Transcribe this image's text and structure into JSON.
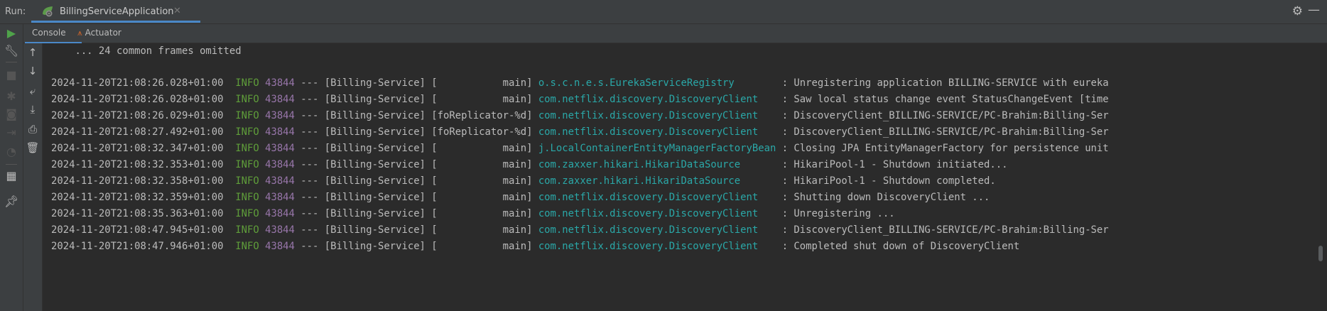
{
  "run": {
    "label": "Run:",
    "config": "BillingServiceApplication"
  },
  "tabs": [
    {
      "label": "Console"
    },
    {
      "label": "Actuator"
    }
  ],
  "console": {
    "omitted": "    ... 24 common frames omitted",
    "logs": [
      {
        "ts": "2024-11-20T21:08:26.028+01:00",
        "level": "INFO",
        "pid": "43844",
        "app": "--- [Billing-Service] [           main] ",
        "logger": "o.s.c.n.e.s.EurekaServiceRegistry       ",
        "msg": " : Unregistering application BILLING-SERVICE with eureka"
      },
      {
        "ts": "2024-11-20T21:08:26.028+01:00",
        "level": "INFO",
        "pid": "43844",
        "app": "--- [Billing-Service] [           main] ",
        "logger": "com.netflix.discovery.DiscoveryClient   ",
        "msg": " : Saw local status change event StatusChangeEvent [time"
      },
      {
        "ts": "2024-11-20T21:08:26.029+01:00",
        "level": "INFO",
        "pid": "43844",
        "app": "--- [Billing-Service] [foReplicator-%d] ",
        "logger": "com.netflix.discovery.DiscoveryClient   ",
        "msg": " : DiscoveryClient_BILLING-SERVICE/PC-Brahim:Billing-Ser"
      },
      {
        "ts": "2024-11-20T21:08:27.492+01:00",
        "level": "INFO",
        "pid": "43844",
        "app": "--- [Billing-Service] [foReplicator-%d] ",
        "logger": "com.netflix.discovery.DiscoveryClient   ",
        "msg": " : DiscoveryClient_BILLING-SERVICE/PC-Brahim:Billing-Ser"
      },
      {
        "ts": "2024-11-20T21:08:32.347+01:00",
        "level": "INFO",
        "pid": "43844",
        "app": "--- [Billing-Service] [           main] ",
        "logger": "j.LocalContainerEntityManagerFactoryBean",
        "msg": " : Closing JPA EntityManagerFactory for persistence unit"
      },
      {
        "ts": "2024-11-20T21:08:32.353+01:00",
        "level": "INFO",
        "pid": "43844",
        "app": "--- [Billing-Service] [           main] ",
        "logger": "com.zaxxer.hikari.HikariDataSource      ",
        "msg": " : HikariPool-1 - Shutdown initiated..."
      },
      {
        "ts": "2024-11-20T21:08:32.358+01:00",
        "level": "INFO",
        "pid": "43844",
        "app": "--- [Billing-Service] [           main] ",
        "logger": "com.zaxxer.hikari.HikariDataSource      ",
        "msg": " : HikariPool-1 - Shutdown completed."
      },
      {
        "ts": "2024-11-20T21:08:32.359+01:00",
        "level": "INFO",
        "pid": "43844",
        "app": "--- [Billing-Service] [           main] ",
        "logger": "com.netflix.discovery.DiscoveryClient   ",
        "msg": " : Shutting down DiscoveryClient ..."
      },
      {
        "ts": "2024-11-20T21:08:35.363+01:00",
        "level": "INFO",
        "pid": "43844",
        "app": "--- [Billing-Service] [           main] ",
        "logger": "com.netflix.discovery.DiscoveryClient   ",
        "msg": " : Unregistering ..."
      },
      {
        "ts": "2024-11-20T21:08:47.945+01:00",
        "level": "INFO",
        "pid": "43844",
        "app": "--- [Billing-Service] [           main] ",
        "logger": "com.netflix.discovery.DiscoveryClient   ",
        "msg": " : DiscoveryClient_BILLING-SERVICE/PC-Brahim:Billing-Ser"
      },
      {
        "ts": "2024-11-20T21:08:47.946+01:00",
        "level": "INFO",
        "pid": "43844",
        "app": "--- [Billing-Service] [           main] ",
        "logger": "com.netflix.discovery.DiscoveryClient   ",
        "msg": " : Completed shut down of DiscoveryClient"
      }
    ]
  }
}
